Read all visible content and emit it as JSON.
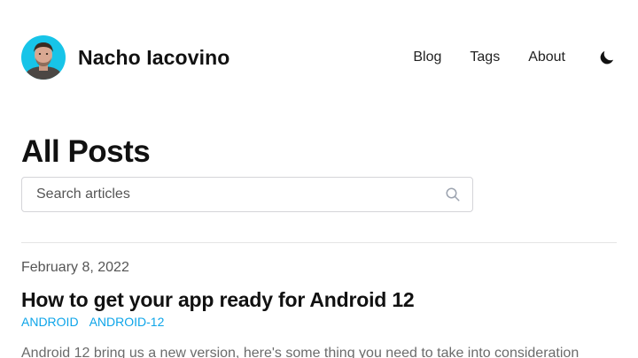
{
  "header": {
    "site_name": "Nacho Iacovino",
    "nav": {
      "blog": "Blog",
      "tags": "Tags",
      "about": "About"
    },
    "theme_toggle_icon": "moon-icon"
  },
  "main": {
    "title": "All Posts",
    "search": {
      "placeholder": "Search articles",
      "value": "",
      "icon": "search-icon"
    },
    "posts": [
      {
        "date": "February 8, 2022",
        "title": "How to get your app ready for Android 12",
        "tags": [
          "ANDROID",
          "ANDROID-12"
        ],
        "summary": "Android 12 bring us a new version, here's some thing you need to take into consideration"
      }
    ]
  },
  "colors": {
    "accent": "#0ea5e9",
    "text": "#111111",
    "muted": "#555555",
    "avatar_bg": "#17c4e8"
  }
}
